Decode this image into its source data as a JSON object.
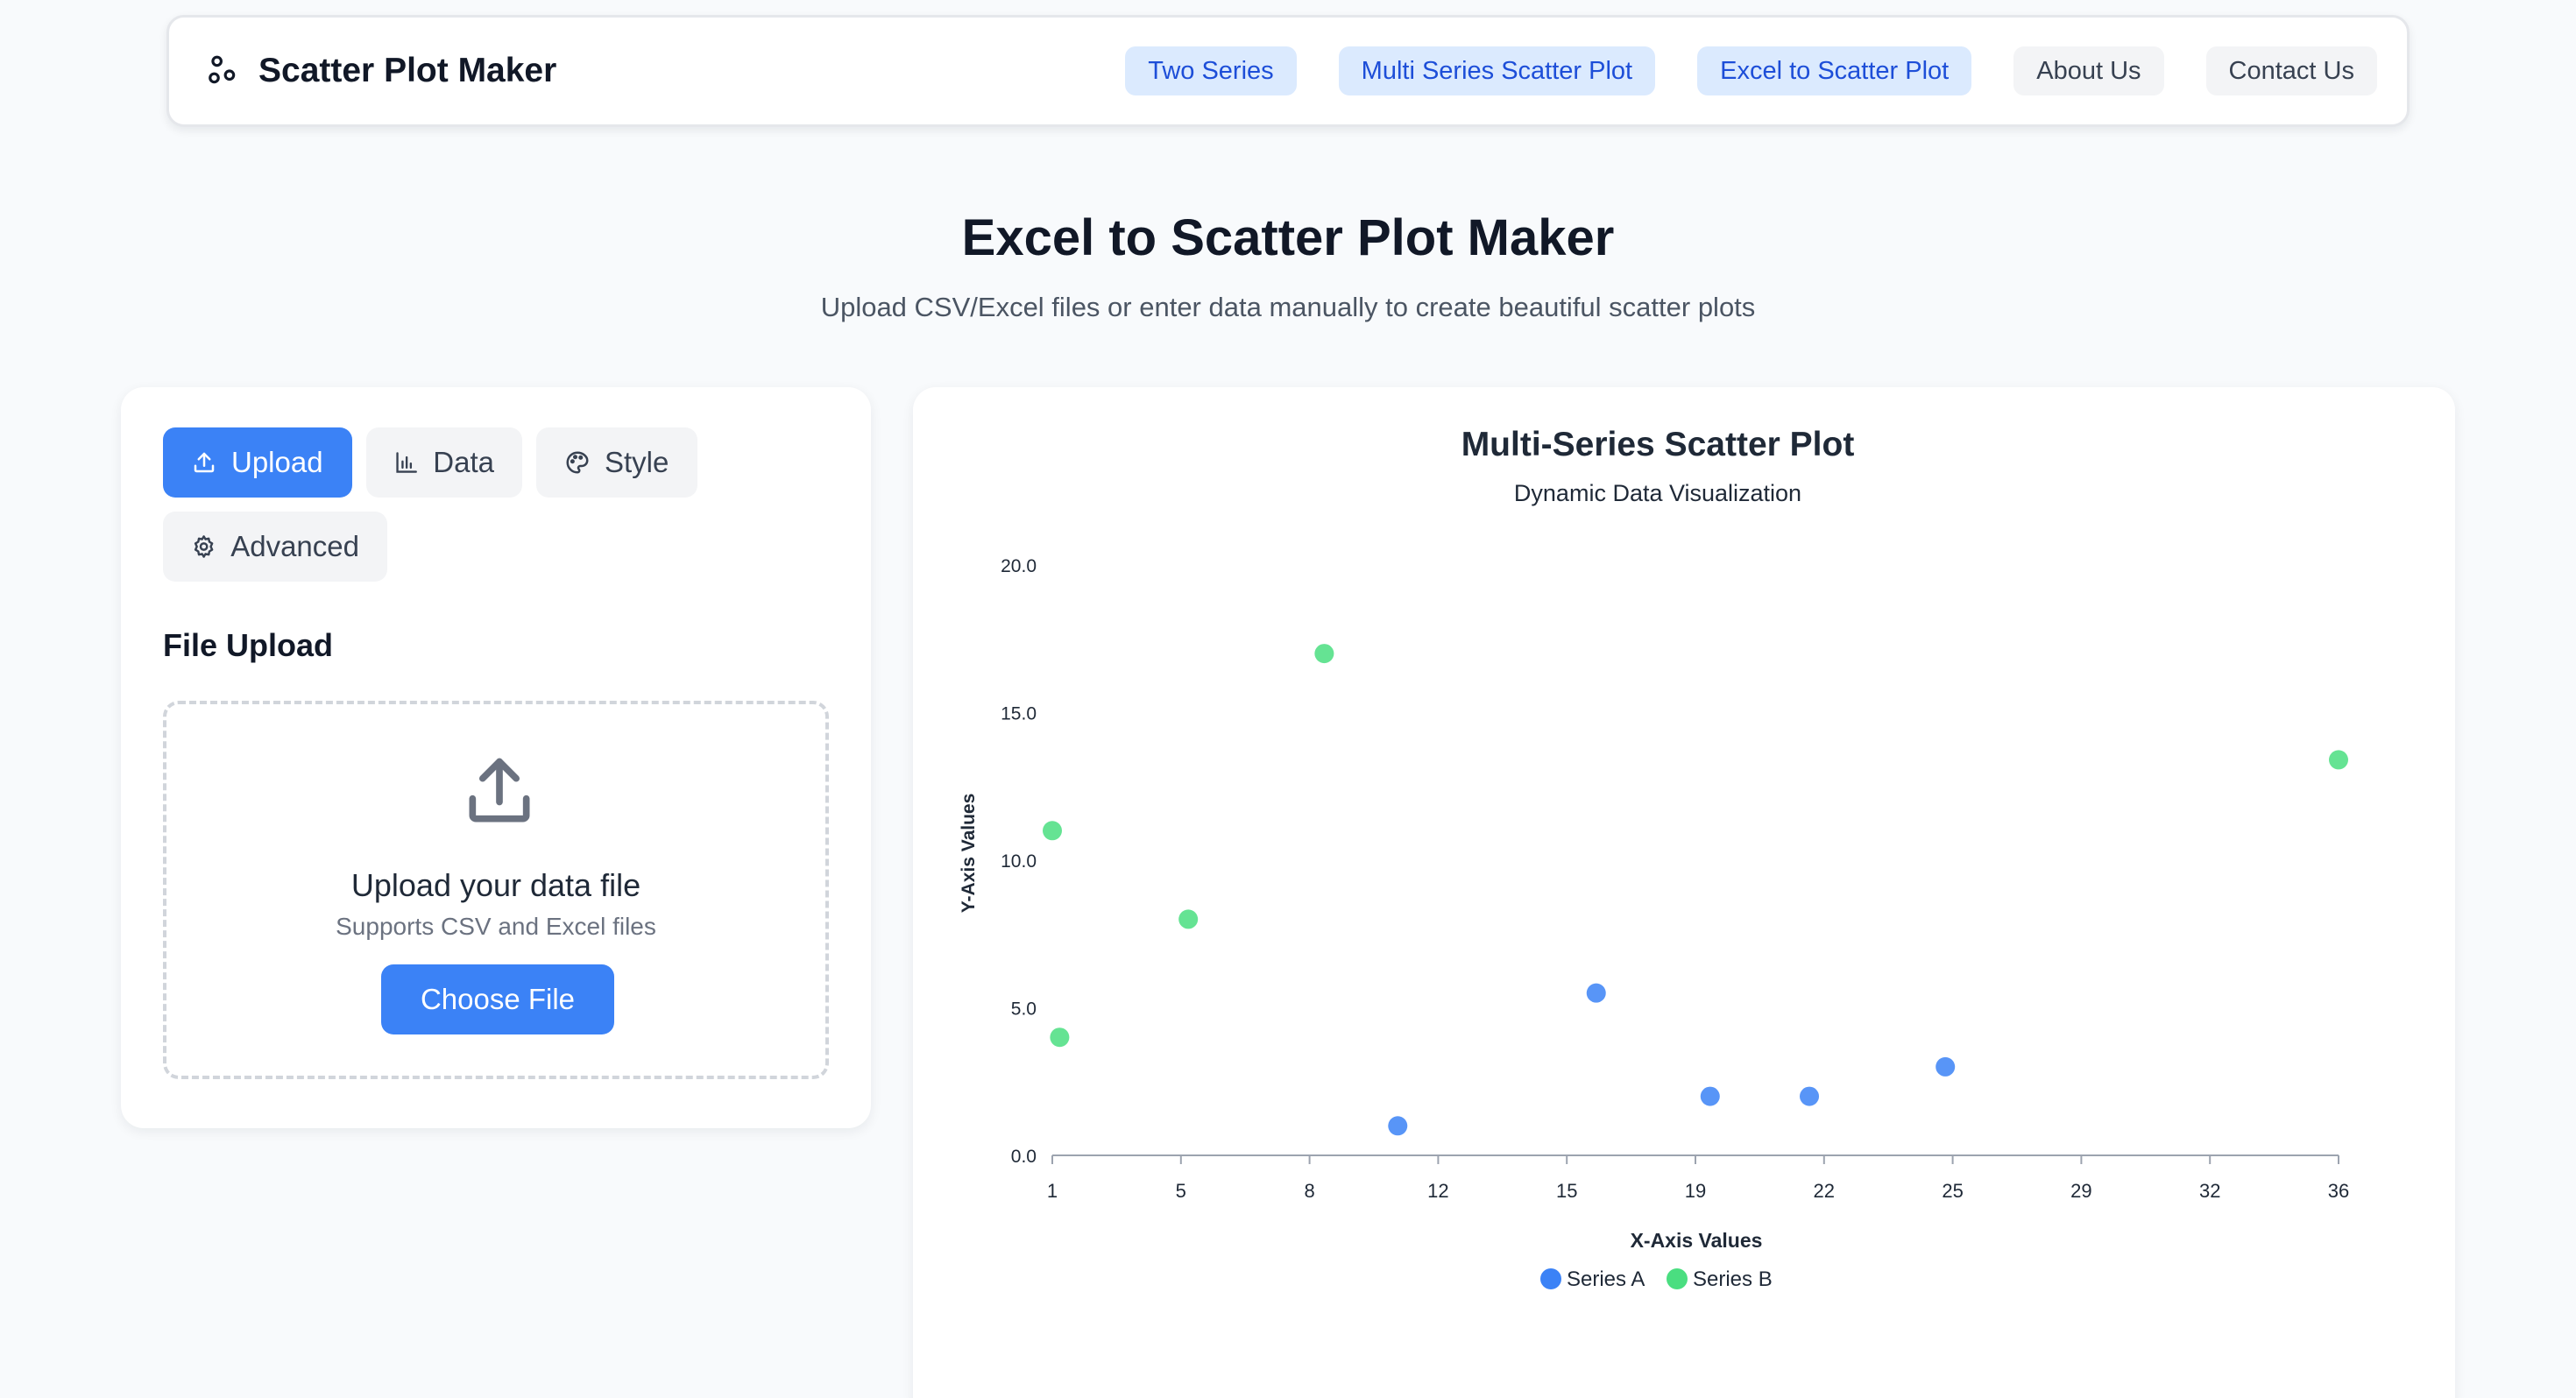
{
  "brand": {
    "title": "Scatter Plot Maker",
    "icon": "scatter-dots-icon"
  },
  "nav": {
    "items": [
      {
        "label": "Two Series",
        "style": "blue"
      },
      {
        "label": "Multi Series Scatter Plot",
        "style": "blue"
      },
      {
        "label": "Excel to Scatter Plot",
        "style": "blue"
      },
      {
        "label": "About Us",
        "style": "gray"
      },
      {
        "label": "Contact Us",
        "style": "gray"
      }
    ]
  },
  "hero": {
    "title": "Excel to Scatter Plot Maker",
    "subtitle": "Upload CSV/Excel files or enter data manually to create beautiful scatter plots"
  },
  "tabs": {
    "upload": {
      "label": "Upload",
      "icon": "upload-icon",
      "active": true
    },
    "data": {
      "label": "Data",
      "icon": "bar-chart-icon",
      "active": false
    },
    "style": {
      "label": "Style",
      "icon": "palette-icon",
      "active": false
    },
    "advanced": {
      "label": "Advanced",
      "icon": "gear-icon",
      "active": false
    }
  },
  "upload": {
    "section_title": "File Upload",
    "drop_title": "Upload your data file",
    "drop_subtitle": "Supports CSV and Excel files",
    "button_label": "Choose File"
  },
  "colors": {
    "accent": "#3b82f6",
    "series_a": "#3b82f6",
    "series_b": "#4ade80"
  },
  "chart_data": {
    "type": "scatter",
    "title": "Multi-Series Scatter Plot",
    "subtitle": "Dynamic Data Visualization",
    "xlabel": "X-Axis Values",
    "ylabel": "Y-Axis Values",
    "xlim": [
      1,
      36
    ],
    "ylim": [
      0,
      20
    ],
    "x_ticks": [
      "1",
      "5",
      "8",
      "12",
      "15",
      "19",
      "22",
      "25",
      "29",
      "32",
      "36"
    ],
    "y_ticks": [
      "0.0",
      "5.0",
      "10.0",
      "15.0",
      "20.0"
    ],
    "grid": false,
    "legend_position": "bottom",
    "series": [
      {
        "name": "Series A",
        "color": "#3b82f6",
        "points": [
          {
            "x": 10.4,
            "y": 1.0
          },
          {
            "x": 15.8,
            "y": 5.5
          },
          {
            "x": 18.9,
            "y": 2.0
          },
          {
            "x": 21.6,
            "y": 2.0
          },
          {
            "x": 25.3,
            "y": 3.0
          }
        ]
      },
      {
        "name": "Series B",
        "color": "#4ade80",
        "points": [
          {
            "x": 1.0,
            "y": 11.0
          },
          {
            "x": 1.2,
            "y": 4.0
          },
          {
            "x": 4.7,
            "y": 8.0
          },
          {
            "x": 8.4,
            "y": 17.0
          },
          {
            "x": 36.0,
            "y": 13.4
          }
        ]
      }
    ]
  }
}
